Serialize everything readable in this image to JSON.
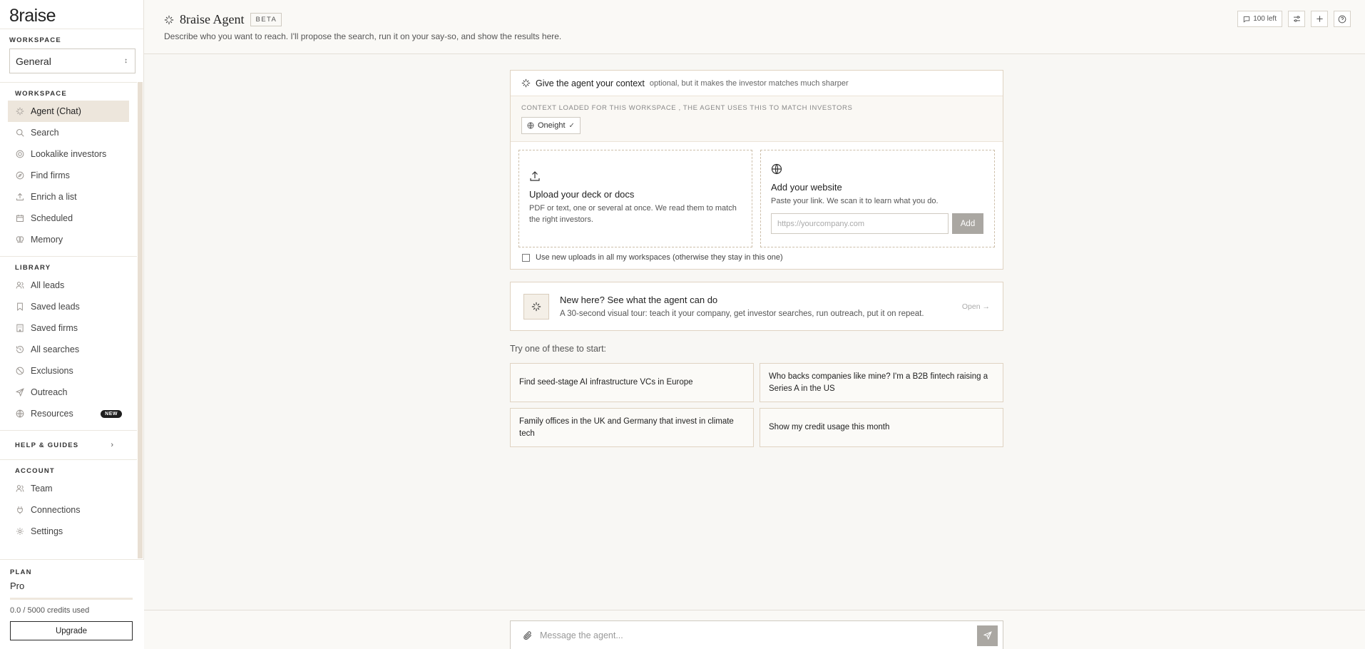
{
  "app": {
    "logo": "8raise"
  },
  "sidebar": {
    "workspace_label": "WORKSPACE",
    "workspace_value": "General",
    "sections": {
      "workspace": {
        "label": "WORKSPACE",
        "items": [
          {
            "label": "Agent (Chat)",
            "icon": "sparkle-icon"
          },
          {
            "label": "Search",
            "icon": "search-icon"
          },
          {
            "label": "Lookalike investors",
            "icon": "lookalike-icon"
          },
          {
            "label": "Find firms",
            "icon": "compass-icon"
          },
          {
            "label": "Enrich a list",
            "icon": "upload-icon"
          },
          {
            "label": "Scheduled",
            "icon": "calendar-icon"
          },
          {
            "label": "Memory",
            "icon": "memory-icon"
          }
        ]
      },
      "library": {
        "label": "LIBRARY",
        "items": [
          {
            "label": "All leads",
            "icon": "users-icon"
          },
          {
            "label": "Saved leads",
            "icon": "bookmark-icon"
          },
          {
            "label": "Saved firms",
            "icon": "building-icon"
          },
          {
            "label": "All searches",
            "icon": "history-icon"
          },
          {
            "label": "Exclusions",
            "icon": "ban-icon"
          },
          {
            "label": "Outreach",
            "icon": "send-icon"
          },
          {
            "label": "Resources",
            "icon": "globe-icon",
            "badge": "NEW"
          }
        ]
      },
      "help": {
        "label": "HELP & GUIDES"
      },
      "account": {
        "label": "ACCOUNT",
        "items": [
          {
            "label": "Team",
            "icon": "team-icon"
          },
          {
            "label": "Connections",
            "icon": "plug-icon"
          },
          {
            "label": "Settings",
            "icon": "gear-icon"
          }
        ]
      }
    },
    "plan": {
      "label": "PLAN",
      "name": "Pro",
      "credits_text": "0.0 / 5000 credits used",
      "credits_used_fraction": 0.0,
      "upgrade_label": "Upgrade"
    }
  },
  "header": {
    "title": "8raise Agent",
    "badge": "BETA",
    "subtitle": "Describe who you want to reach. I'll propose the search, run it on your say-so, and show the results here.",
    "credits_label": "100 left"
  },
  "context": {
    "title": "Give the agent your context",
    "optional": "optional, but it makes the investor matches much sharper",
    "loaded_label": "CONTEXT LOADED FOR THIS WORKSPACE , THE AGENT USES THIS TO MATCH INVESTORS",
    "chip_label": "Oneight",
    "upload": {
      "title": "Upload your deck or docs",
      "desc": "PDF or text, one or several at once. We read them to match the right investors."
    },
    "website": {
      "title": "Add your website",
      "desc": "Paste your link. We scan it to learn what you do.",
      "placeholder": "https://yourcompany.com",
      "add_label": "Add"
    },
    "checkbox_label": "Use new uploads in all my workspaces (otherwise they stay in this one)"
  },
  "tour": {
    "title": "New here? See what the agent can do",
    "desc": "A 30-second visual tour: teach it your company, get investor searches, run outreach, put it on repeat.",
    "open_label": "Open →"
  },
  "suggestions": {
    "label": "Try one of these to start:",
    "items": [
      "Find seed-stage AI infrastructure VCs in Europe",
      "Who backs companies like mine? I'm a B2B fintech raising a Series A in the US",
      "Family offices in the UK and Germany that invest in climate tech",
      "Show my credit usage this month"
    ]
  },
  "composer": {
    "placeholder": "Message the agent..."
  }
}
